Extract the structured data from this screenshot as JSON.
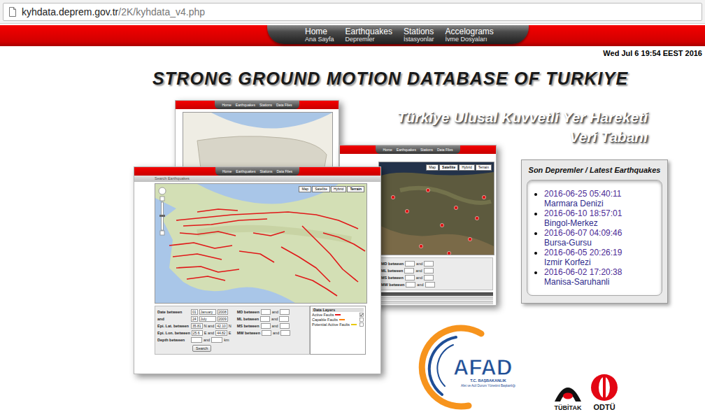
{
  "browser": {
    "host": "kyhdata.deprem.gov.tr",
    "path": "/2K/kyhdata_v4.php"
  },
  "nav": [
    {
      "label": "Home",
      "sub": "Ana Sayfa"
    },
    {
      "label": "Earthquakes",
      "sub": "Depremler"
    },
    {
      "label": "Stations",
      "sub": "İstasyonlar"
    },
    {
      "label": "Accelograms",
      "sub": "İvme Dosyaları"
    }
  ],
  "clock": "Wed Jul 6 19:54 EEST 2016",
  "title": "STRONG GROUND MOTION DATABASE OF TURKIYE",
  "subtitle": [
    "Türkiye Ulusal Kuvvetli Yer Hareketi",
    "Veri Tabanı"
  ],
  "latest_earthquakes": {
    "title": "Son Depremler / Latest Earthquakes",
    "items": [
      {
        "time": "2016-06-25 05:40:11",
        "place": "Marmara Denizi"
      },
      {
        "time": "2016-06-10 18:57:01",
        "place": "Bingol-Merkez"
      },
      {
        "time": "2016-06-07 04:09:46",
        "place": "Bursa-Gursu"
      },
      {
        "time": "2016-06-05 20:26:19",
        "place": "Izmir Korfezi"
      },
      {
        "time": "2016-06-02 17:20:38",
        "place": "Manisa-Saruhanli"
      }
    ]
  },
  "preview": {
    "nav": [
      "Home",
      "Earthquakes",
      "Stations",
      "Data Files"
    ],
    "search_strip": "Search Earthquakes",
    "terrain_map_types": [
      {
        "label": "Map",
        "selected": false
      },
      {
        "label": "Satellite",
        "selected": false
      },
      {
        "label": "Hybrid",
        "selected": false
      },
      {
        "label": "Terrain",
        "selected": true
      }
    ],
    "satellite_map_types": [
      {
        "label": "Map",
        "selected": false
      },
      {
        "label": "Satellite",
        "selected": true
      },
      {
        "label": "Hybrid",
        "selected": false
      },
      {
        "label": "Terrain",
        "selected": false
      }
    ],
    "form": {
      "date_rows": [
        {
          "label": "Date between",
          "day": "01",
          "month": "January",
          "year": "2008"
        },
        {
          "label": "and",
          "day": "24",
          "month": "July",
          "year": "2009"
        }
      ],
      "coord_rows": [
        {
          "label": "Epi. Lat. between",
          "from": "35.81",
          "unit_from": "N and",
          "to": "42.10",
          "unit_to": "N"
        },
        {
          "label": "Epi. Lon. between",
          "from": "25.6",
          "unit_from": "E and",
          "to": "44.82",
          "unit_to": "E"
        }
      ],
      "depth": {
        "label": "Depth between",
        "joiner": "and",
        "unit": "km"
      },
      "magnitudes": [
        {
          "label": "MD between",
          "joiner": "and"
        },
        {
          "label": "ML between",
          "joiner": "and"
        },
        {
          "label": "MS between",
          "joiner": "and"
        },
        {
          "label": "MW between",
          "joiner": "and"
        }
      ],
      "layers": {
        "title": "Data Layers",
        "items": [
          {
            "label": "Active Faults",
            "checked": true,
            "color": "#e41a1c"
          },
          {
            "label": "Capable Faults",
            "checked": false,
            "color": "#ff7f00"
          },
          {
            "label": "Potential Active Faults",
            "checked": false,
            "color": "#e8c800"
          }
        ]
      },
      "search_button": "Search"
    }
  },
  "logos": {
    "afad": {
      "name": "AFAD",
      "line1": "T.C. BAŞBAKANLIK",
      "line2": "Afet ve Acil Durum Yönetimi Başkanlığı"
    },
    "tubitak": "TÜBİTAK",
    "odtu": "ODTÜ"
  }
}
